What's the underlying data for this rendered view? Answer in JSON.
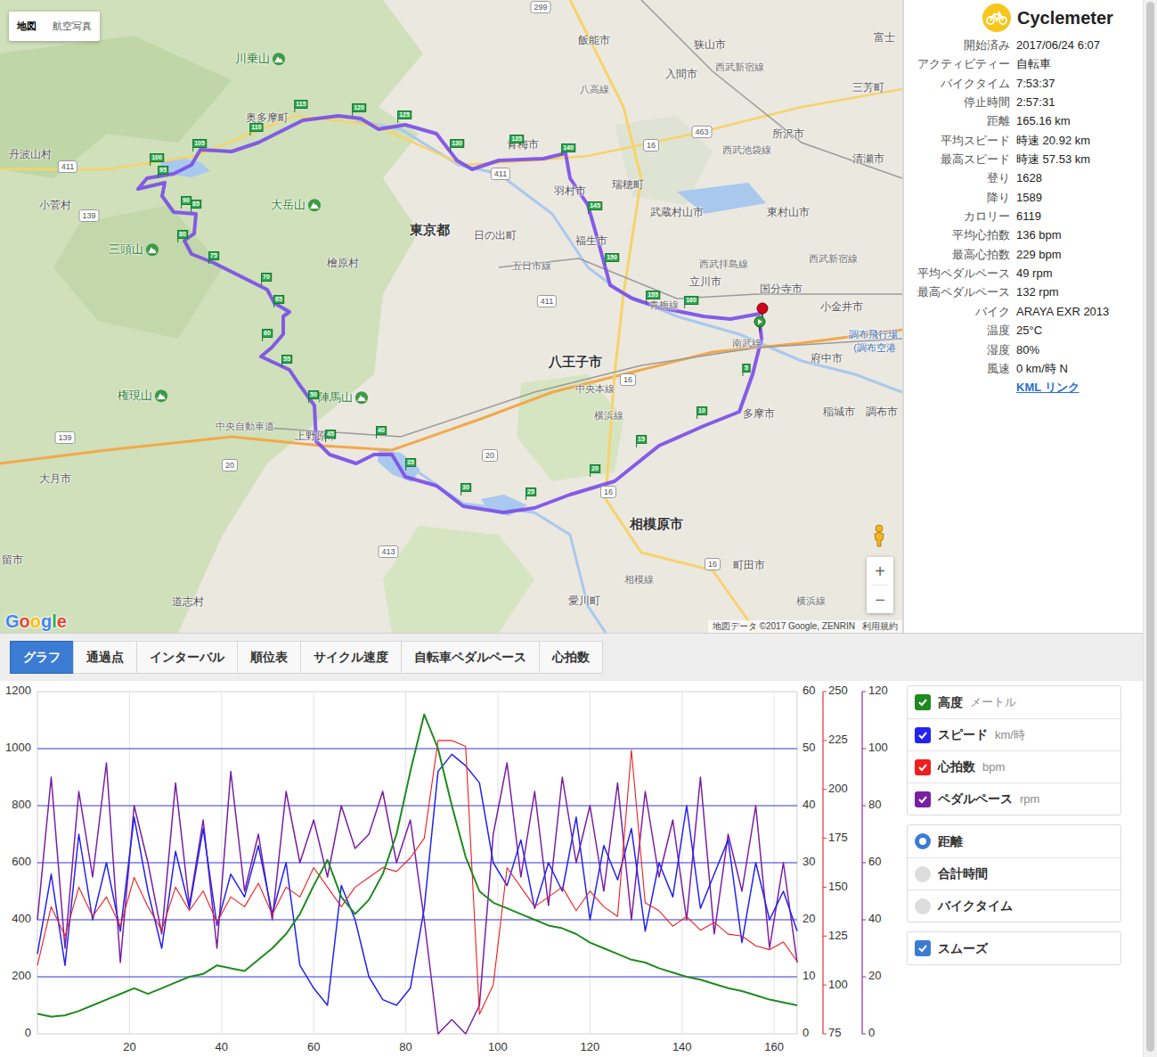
{
  "map": {
    "view_buttons": [
      {
        "label": "地図",
        "selected": true
      },
      {
        "label": "航空写真",
        "selected": false
      }
    ],
    "labels": [
      {
        "text": "飯能市",
        "kind": "city"
      },
      {
        "text": "狭山市",
        "kind": "city"
      },
      {
        "text": "入間市",
        "kind": "city"
      },
      {
        "text": "三芳町",
        "kind": "city"
      },
      {
        "text": "富士",
        "kind": "city"
      },
      {
        "text": "所沢市",
        "kind": "city"
      },
      {
        "text": "清瀬市",
        "kind": "city"
      },
      {
        "text": "川乗山",
        "kind": "mountain"
      },
      {
        "text": "奥多摩町",
        "kind": "city"
      },
      {
        "text": "丹波山村",
        "kind": "city"
      },
      {
        "text": "小菅村",
        "kind": "city"
      },
      {
        "text": "大岳山",
        "kind": "mountain"
      },
      {
        "text": "三頭山",
        "kind": "mountain"
      },
      {
        "text": "檜原村",
        "kind": "city"
      },
      {
        "text": "東京都",
        "kind": "major"
      },
      {
        "text": "日の出町",
        "kind": "city"
      },
      {
        "text": "青梅市",
        "kind": "city"
      },
      {
        "text": "羽村市",
        "kind": "city"
      },
      {
        "text": "瑞穂町",
        "kind": "city"
      },
      {
        "text": "福生市",
        "kind": "city"
      },
      {
        "text": "武蔵村山市",
        "kind": "city"
      },
      {
        "text": "東村山市",
        "kind": "city"
      },
      {
        "text": "立川市",
        "kind": "city"
      },
      {
        "text": "国分寺市",
        "kind": "city"
      },
      {
        "text": "小金井市",
        "kind": "city"
      },
      {
        "text": "府中市",
        "kind": "city"
      },
      {
        "text": "八王子市",
        "kind": "major"
      },
      {
        "text": "多摩市",
        "kind": "city"
      },
      {
        "text": "稲城市",
        "kind": "city"
      },
      {
        "text": "調布市",
        "kind": "city"
      },
      {
        "text": "調布飛行場",
        "kind": "airport"
      },
      {
        "text": "(調布空港",
        "kind": "airport"
      },
      {
        "text": "権現山",
        "kind": "mountain"
      },
      {
        "text": "陣馬山",
        "kind": "mountain"
      },
      {
        "text": "上野原市",
        "kind": "city"
      },
      {
        "text": "大月市",
        "kind": "city"
      },
      {
        "text": "相模原市",
        "kind": "major"
      },
      {
        "text": "町田市",
        "kind": "city"
      },
      {
        "text": "愛川町",
        "kind": "city"
      },
      {
        "text": "道志村",
        "kind": "city"
      },
      {
        "text": "留市",
        "kind": "city"
      },
      {
        "text": "五日市線",
        "kind": "rail"
      },
      {
        "text": "西武拝島線",
        "kind": "rail"
      },
      {
        "text": "青梅線",
        "kind": "rail"
      },
      {
        "text": "南武線",
        "kind": "rail"
      },
      {
        "text": "中央本線",
        "kind": "rail"
      },
      {
        "text": "中央自動車道",
        "kind": "rail"
      },
      {
        "text": "横浜線",
        "kind": "rail"
      },
      {
        "text": "西武新宿線",
        "kind": "rail"
      },
      {
        "text": "西武池袋線",
        "kind": "rail"
      },
      {
        "text": "八高線",
        "kind": "rail"
      },
      {
        "text": "西武新宿線",
        "kind": "rail"
      },
      {
        "text": "相模線",
        "kind": "rail"
      },
      {
        "text": "横浜線",
        "kind": "rail"
      },
      {
        "text": "299",
        "kind": "road"
      },
      {
        "text": "463",
        "kind": "road"
      },
      {
        "text": "16",
        "kind": "road"
      },
      {
        "text": "411",
        "kind": "road"
      },
      {
        "text": "411",
        "kind": "road"
      },
      {
        "text": "139",
        "kind": "road"
      },
      {
        "text": "411",
        "kind": "road"
      },
      {
        "text": "16",
        "kind": "road"
      },
      {
        "text": "20",
        "kind": "road"
      },
      {
        "text": "139",
        "kind": "road"
      },
      {
        "text": "20",
        "kind": "road"
      },
      {
        "text": "16",
        "kind": "road"
      },
      {
        "text": "413",
        "kind": "road"
      },
      {
        "text": "16",
        "kind": "road"
      }
    ],
    "km_markers": [
      "5",
      "10",
      "15",
      "20",
      "25",
      "30",
      "35",
      "40",
      "45",
      "50",
      "55",
      "60",
      "65",
      "70",
      "75",
      "80",
      "85",
      "90",
      "95",
      "100",
      "105",
      "110",
      "115",
      "120",
      "125",
      "130",
      "135",
      "140",
      "145",
      "150",
      "155",
      "160"
    ],
    "zoom": [
      "+",
      "−"
    ],
    "logo": "Google",
    "attribution": "地図データ ©2017 Google, ZENRIN",
    "terms": "利用規約"
  },
  "stats": {
    "app": "Cyclemeter",
    "rows": [
      {
        "label": "開始済み",
        "value": "2017/06/24 6:07"
      },
      {
        "label": "アクティビティー",
        "value": "自転車"
      },
      {
        "label": "バイクタイム",
        "value": "7:53:37"
      },
      {
        "label": "停止時間",
        "value": "2:57:31"
      },
      {
        "label": "距離",
        "value": "165.16 km"
      },
      {
        "label": "平均スピード",
        "value": "時速 20.92 km"
      },
      {
        "label": "最高スピード",
        "value": "時速 57.53 km"
      },
      {
        "label": "登り",
        "value": "1628"
      },
      {
        "label": "降り",
        "value": "1589"
      },
      {
        "label": "カロリー",
        "value": "6119"
      },
      {
        "label": "平均心拍数",
        "value": "136 bpm"
      },
      {
        "label": "最高心拍数",
        "value": "229 bpm"
      },
      {
        "label": "平均ペダルペース",
        "value": "49 rpm"
      },
      {
        "label": "最高ペダルペース",
        "value": "132 rpm"
      },
      {
        "label": "バイク",
        "value": "ARAYA EXR 2013"
      },
      {
        "label": "温度",
        "value": "25°C"
      },
      {
        "label": "湿度",
        "value": "80%"
      },
      {
        "label": "風速",
        "value": "0 km/時 N"
      }
    ],
    "link": "KML リンク"
  },
  "tabs": [
    {
      "label": "グラフ",
      "selected": true
    },
    {
      "label": "通過点",
      "selected": false
    },
    {
      "label": "インターバル",
      "selected": false
    },
    {
      "label": "順位表",
      "selected": false
    },
    {
      "label": "サイクル速度",
      "selected": false
    },
    {
      "label": "自転車ペダルペース",
      "selected": false
    },
    {
      "label": "心拍数",
      "selected": false
    }
  ],
  "chart": {
    "axes": {
      "left": [
        "0",
        "200",
        "400",
        "600",
        "800",
        "1000",
        "1200"
      ],
      "speed": [
        "0",
        "10",
        "20",
        "30",
        "40",
        "50",
        "60"
      ],
      "heart": [
        "75",
        "100",
        "125",
        "150",
        "175",
        "200",
        "225",
        "250"
      ],
      "cadence": [
        "0",
        "20",
        "40",
        "60",
        "80",
        "100",
        "120"
      ],
      "x": [
        "20",
        "40",
        "60",
        "80",
        "100",
        "120",
        "140",
        "160"
      ]
    },
    "series": [
      {
        "label": "高度",
        "unit": "メートル",
        "checked": true,
        "color": "#1f8a1f",
        "values": [
          70,
          60,
          65,
          80,
          100,
          120,
          140,
          160,
          140,
          160,
          180,
          200,
          210,
          240,
          230,
          220,
          260,
          300,
          350,
          420,
          520,
          610,
          480,
          420,
          470,
          560,
          700,
          920,
          1120,
          1000,
          800,
          620,
          500,
          460,
          440,
          420,
          400,
          380,
          370,
          350,
          320,
          300,
          280,
          260,
          250,
          230,
          215,
          200,
          190,
          175,
          160,
          150,
          135,
          120,
          110,
          100
        ]
      },
      {
        "label": "スピード",
        "unit": "km/時",
        "checked": true,
        "color": "#2323f0",
        "values": [
          14,
          28,
          12,
          35,
          20,
          30,
          18,
          38,
          25,
          15,
          32,
          22,
          36,
          19,
          28,
          24,
          33,
          21,
          30,
          12,
          8,
          5,
          26,
          20,
          10,
          6,
          5,
          8,
          22,
          46,
          49,
          47,
          44,
          30,
          26,
          34,
          22,
          30,
          25,
          38,
          20,
          33,
          27,
          36,
          18,
          30,
          24,
          40,
          22,
          28,
          34,
          16,
          30,
          20,
          25,
          18
        ]
      },
      {
        "label": "心拍数",
        "unit": "bpm",
        "checked": true,
        "color": "#f01e1e",
        "values": [
          110,
          140,
          125,
          150,
          135,
          145,
          130,
          155,
          140,
          128,
          150,
          138,
          148,
          132,
          145,
          140,
          152,
          136,
          150,
          145,
          160,
          150,
          140,
          150,
          155,
          160,
          158,
          165,
          175,
          225,
          225,
          222,
          85,
          100,
          160,
          150,
          140,
          145,
          150,
          138,
          148,
          140,
          135,
          220,
          142,
          138,
          130,
          135,
          128,
          132,
          126,
          125,
          120,
          118,
          122,
          112
        ]
      },
      {
        "label": "ペダルペース",
        "unit": "rpm",
        "checked": true,
        "color": "#7a1fa2",
        "values": [
          40,
          90,
          30,
          85,
          55,
          95,
          25,
          80,
          60,
          35,
          88,
          45,
          75,
          30,
          92,
          50,
          70,
          40,
          85,
          60,
          75,
          55,
          80,
          65,
          70,
          85,
          60,
          75,
          40,
          0,
          5,
          0,
          10,
          70,
          95,
          55,
          85,
          45,
          90,
          60,
          80,
          50,
          88,
          40,
          85,
          55,
          75,
          40,
          90,
          35,
          70,
          50,
          80,
          30,
          60,
          25
        ]
      }
    ],
    "x_options": [
      {
        "label": "距離",
        "selected": true
      },
      {
        "label": "合計時間",
        "selected": false
      },
      {
        "label": "バイクタイム",
        "selected": false
      }
    ],
    "smooth": {
      "label": "スムーズ",
      "checked": true
    }
  }
}
